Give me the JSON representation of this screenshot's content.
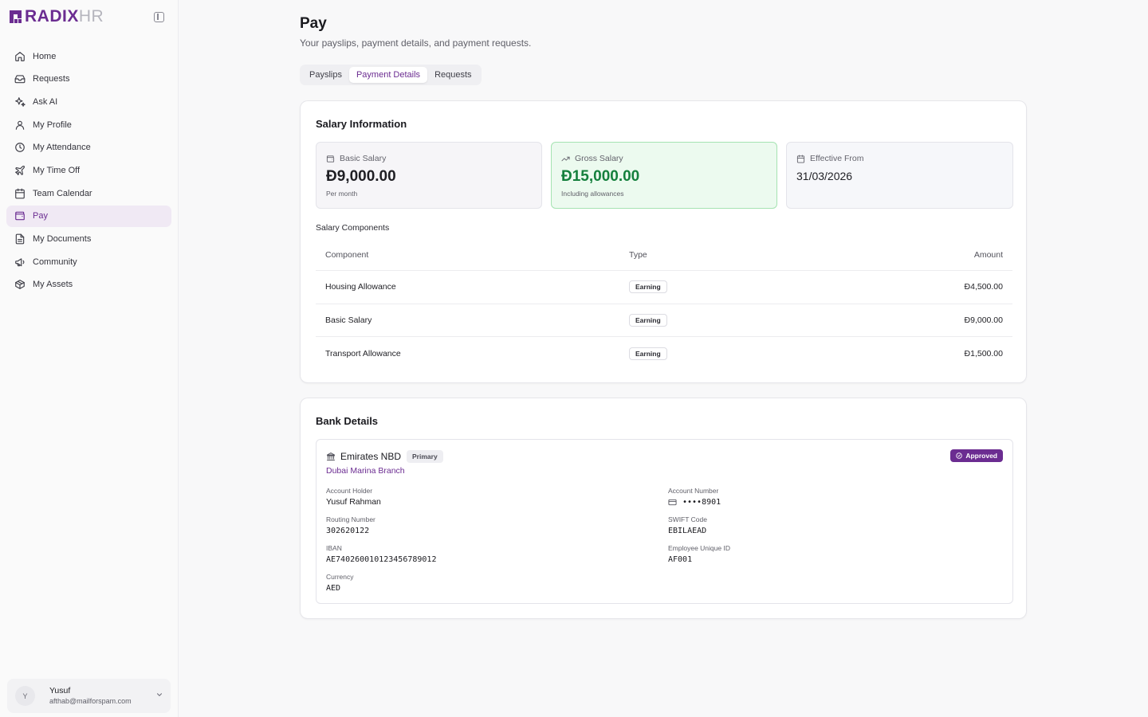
{
  "brand": {
    "name_main": "RADIX",
    "name_suffix": "HR"
  },
  "sidebar": {
    "items": [
      {
        "label": "Home",
        "icon": "home-icon"
      },
      {
        "label": "Requests",
        "icon": "inbox-icon"
      },
      {
        "label": "Ask AI",
        "icon": "sparkles-icon"
      },
      {
        "label": "My Profile",
        "icon": "user-icon"
      },
      {
        "label": "My Attendance",
        "icon": "clock-icon"
      },
      {
        "label": "My Time Off",
        "icon": "plane-icon"
      },
      {
        "label": "Team Calendar",
        "icon": "calendar-icon"
      },
      {
        "label": "Pay",
        "icon": "wallet-icon",
        "active": true
      },
      {
        "label": "My Documents",
        "icon": "document-icon"
      },
      {
        "label": "Community",
        "icon": "megaphone-icon"
      },
      {
        "label": "My Assets",
        "icon": "box-icon"
      }
    ]
  },
  "user": {
    "initial": "Y",
    "name": "Yusuf",
    "email": "afthab@mailforspam.com"
  },
  "header": {
    "title": "Pay",
    "subtitle": "Your payslips, payment details, and payment requests."
  },
  "tabs": [
    {
      "label": "Payslips",
      "active": false
    },
    {
      "label": "Payment Details",
      "active": true
    },
    {
      "label": "Requests",
      "active": false
    }
  ],
  "salary": {
    "title": "Salary Information",
    "basic": {
      "label": "Basic Salary",
      "value": "Ð9,000.00",
      "note": "Per month"
    },
    "gross": {
      "label": "Gross Salary",
      "value": "Ð15,000.00",
      "note": "Including allowances"
    },
    "effective": {
      "label": "Effective From",
      "value": "31/03/2026"
    },
    "components_label": "Salary Components",
    "columns": {
      "component": "Component",
      "type": "Type",
      "amount": "Amount"
    },
    "rows": [
      {
        "component": "Housing Allowance",
        "type": "Earning",
        "amount": "Ð4,500.00"
      },
      {
        "component": "Basic Salary",
        "type": "Earning",
        "amount": "Ð9,000.00"
      },
      {
        "component": "Transport Allowance",
        "type": "Earning",
        "amount": "Ð1,500.00"
      }
    ]
  },
  "bank": {
    "title": "Bank Details",
    "name": "Emirates NBD",
    "primary_badge": "Primary",
    "branch": "Dubai Marina Branch",
    "status": "Approved",
    "fields": {
      "account_holder": {
        "label": "Account Holder",
        "value": "Yusuf Rahman"
      },
      "account_number": {
        "label": "Account Number",
        "value": "••••8901"
      },
      "routing_number": {
        "label": "Routing Number",
        "value": "302620122"
      },
      "swift_code": {
        "label": "SWIFT Code",
        "value": "EBILAEAD"
      },
      "iban": {
        "label": "IBAN",
        "value": "AE740260010123456789012"
      },
      "employee_id": {
        "label": "Employee Unique ID",
        "value": "AF001"
      },
      "currency": {
        "label": "Currency",
        "value": "AED"
      }
    }
  },
  "colors": {
    "accent": "#6b2c91",
    "accent_soft": "#f0e9f4",
    "success": "#15803d",
    "success_bg": "#ecfaef"
  }
}
